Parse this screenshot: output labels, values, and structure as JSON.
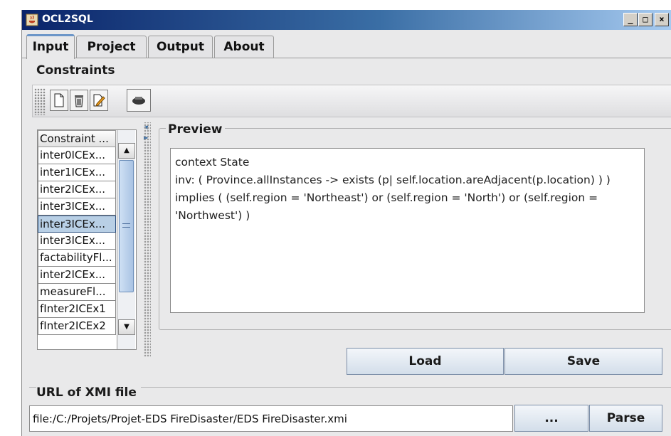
{
  "window": {
    "title": "OCL2SQL",
    "minimize": "_",
    "maximize": "□",
    "close": "×"
  },
  "tabs": [
    {
      "label": "Input",
      "active": true
    },
    {
      "label": "Project",
      "active": false
    },
    {
      "label": "Output",
      "active": false
    },
    {
      "label": "About",
      "active": false
    }
  ],
  "constraints": {
    "title": "Constraints",
    "toolbar": {
      "icons": [
        "new-document-icon",
        "delete-trash-icon",
        "edit-icon",
        "run-icon"
      ]
    },
    "list": {
      "header": "Constraint ...",
      "items": [
        {
          "label": "inter0ICEx...",
          "selected": false
        },
        {
          "label": "inter1ICEx...",
          "selected": false
        },
        {
          "label": "inter2ICEx...",
          "selected": false
        },
        {
          "label": "inter3ICEx...",
          "selected": false
        },
        {
          "label": "inter3ICEx...",
          "selected": true
        },
        {
          "label": "inter3ICEx...",
          "selected": false
        },
        {
          "label": "factabilityFl...",
          "selected": false
        },
        {
          "label": "inter2ICEx...",
          "selected": false
        },
        {
          "label": "measureFl...",
          "selected": false
        },
        {
          "label": "fInter2ICEx1",
          "selected": false
        },
        {
          "label": "fInter2ICEx2",
          "selected": false
        }
      ]
    }
  },
  "preview": {
    "title": "Preview",
    "lines": [
      "context  State",
      "inv: ( Province.allInstances -> exists (p| self.location.areAdjacent(p.location) ) )",
      "implies ( (self.region = 'Northeast') or (self.region = 'North') or (self.region =",
      "'Northwest') )"
    ]
  },
  "buttons": {
    "load": "Load",
    "save": "Save"
  },
  "xmi": {
    "title": "URL of XMI file",
    "path": "file:/C:/Projets/Projet-EDS FireDisaster/EDS FireDisaster.xmi",
    "browse": "...",
    "parse": "Parse"
  },
  "colors": {
    "titlebar": "#0a246a",
    "tab_accent": "#6c96c8",
    "selection": "#b8cfe5"
  }
}
